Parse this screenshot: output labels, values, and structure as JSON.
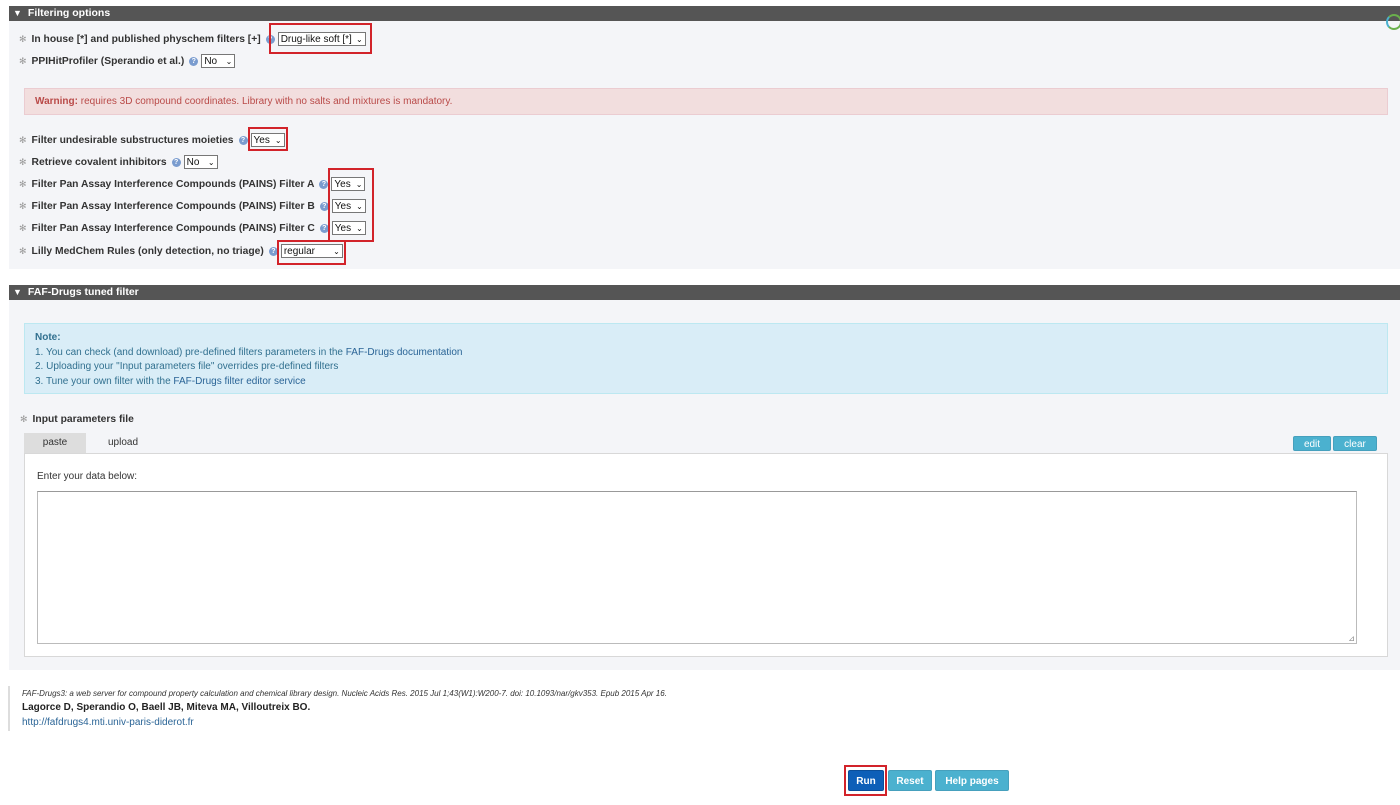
{
  "filtering": {
    "header": "Filtering options",
    "rows": [
      {
        "label": "In house [*] and published physchem filters [+]",
        "value": "Drug-like soft [*]"
      },
      {
        "label": "PPIHitProfiler (Sperandio et al.)",
        "value": "No"
      },
      {
        "label": "Filter undesirable substructures moieties",
        "value": "Yes"
      },
      {
        "label": "Retrieve covalent inhibitors",
        "value": "No"
      },
      {
        "label": "Filter Pan Assay Interference Compounds (PAINS) Filter A",
        "value": "Yes"
      },
      {
        "label": "Filter Pan Assay Interference Compounds (PAINS) Filter B",
        "value": "Yes"
      },
      {
        "label": "Filter Pan Assay Interference Compounds (PAINS) Filter C",
        "value": "Yes"
      },
      {
        "label": "Lilly MedChem Rules (only detection, no triage)",
        "value": "regular"
      }
    ],
    "warning_bold": "Warning:",
    "warning_text": " requires 3D compound coordinates. Library with no salts and mixtures is mandatory."
  },
  "tuned": {
    "header": "FAF-Drugs tuned filter",
    "note_title": "Note:",
    "note_1_pre": "1. You can check (and download) pre-defined filters parameters in the ",
    "note_1_link": "FAF-Drugs documentation",
    "note_2": "2. Uploading your \"Input parameters file\" overrides pre-defined filters",
    "note_3_pre": "3. Tune your own filter with the ",
    "note_3_link": "FAF-Drugs filter editor service",
    "input_label": "Input parameters file",
    "tab_paste": "paste",
    "tab_upload": "upload",
    "edit_label": "edit",
    "clear_label": "clear",
    "enter_data": "Enter your data below:"
  },
  "footer": {
    "citation": "FAF-Drugs3: a web server for compound property calculation and chemical library design. Nucleic Acids Res. 2015 Jul 1;43(W1):W200-7. doi: 10.1093/nar/gkv353. Epub 2015 Apr 16.",
    "authors": "Lagorce D, Sperandio O, Baell JB, Miteva MA, Villoutreix BO.",
    "url": "http://fafdrugs4.mti.univ-paris-diderot.fr"
  },
  "actions": {
    "run": "Run",
    "reset": "Reset",
    "help": "Help pages"
  },
  "colors": {
    "highlight": "#d2232a",
    "run": "#0d5fb8",
    "secondary": "#4bb1cf"
  }
}
